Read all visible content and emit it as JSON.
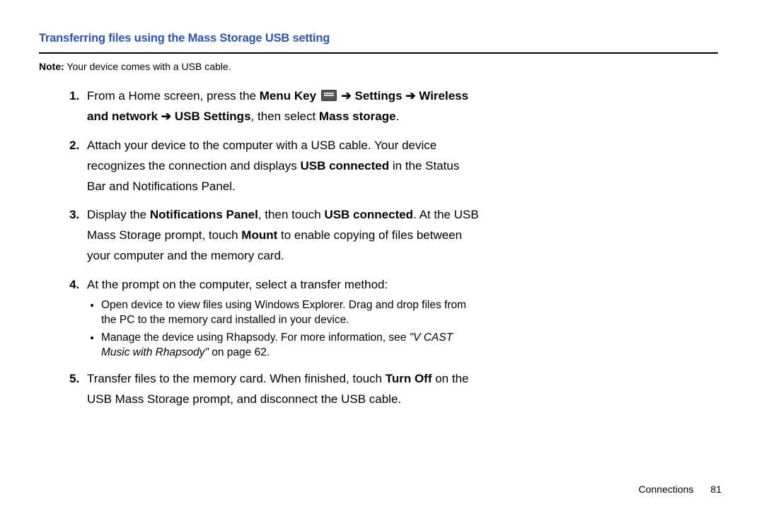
{
  "heading": "Transferring files using the Mass Storage USB setting",
  "note_label": "Note:",
  "note_text": " Your device comes with a USB cable.",
  "arrow": "➔",
  "steps": {
    "s1_a": "From a Home screen, press the ",
    "s1_menukey": "Menu Key",
    "s1_b": " ",
    "s1_settings": "Settings",
    "s1_c": " ",
    "s1_wn": "Wireless and network",
    "s1_d": " ",
    "s1_usb": "USB Settings",
    "s1_e": ", then select ",
    "s1_mass": "Mass storage",
    "s1_f": ".",
    "s2_a": "Attach your device to the computer with a USB cable. Your device recognizes the connection and displays ",
    "s2_b": "USB connected",
    "s2_c": " in the Status Bar and Notifications Panel.",
    "s3_a": "Display the ",
    "s3_np": "Notifications Panel",
    "s3_b": ", then touch ",
    "s3_uc": "USB connected",
    "s3_c": ". At the USB Mass Storage prompt, touch ",
    "s3_mount": "Mount",
    "s3_d": " to enable copying of files between your computer and the memory card.",
    "s4_a": "At the prompt on the computer, select a transfer method:",
    "s4_b1": "Open device to view files using Windows Explorer. Drag and drop files from the PC to the memory card installed in your device.",
    "s4_b2a": "Manage the device using Rhapsody. For more information, see ",
    "s4_b2b": "\"V CAST Music with Rhapsody\"",
    "s4_b2c": " on page 62.",
    "s5_a": "Transfer files to the memory card. When finished, touch ",
    "s5_off": "Turn Off",
    "s5_b": " on the USB Mass Storage prompt, and disconnect the USB cable."
  },
  "footer_section": "Connections",
  "footer_page": "81"
}
